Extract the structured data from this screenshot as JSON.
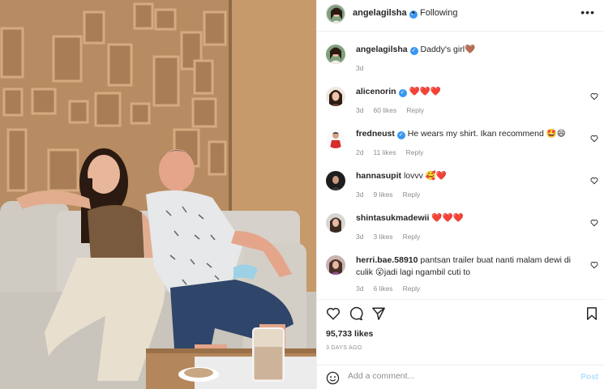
{
  "header": {
    "username": "angelagilsha",
    "dot": "•",
    "follow_status": "Following",
    "more": "•••"
  },
  "caption": {
    "username": "angelagilsha",
    "text": "Daddy's girl🤎",
    "time": "3d"
  },
  "comments": [
    {
      "username": "alicenorin",
      "text": "❤️❤️❤️",
      "time": "3d",
      "likes": "60 likes",
      "reply": "Reply",
      "verified": true
    },
    {
      "username": "fredneust",
      "text": "He wears my shirt. Ikan recommend 🤩😄",
      "time": "2d",
      "likes": "11 likes",
      "reply": "Reply",
      "verified": true
    },
    {
      "username": "hannasupit",
      "text": "lovvv 🥰❤️",
      "time": "3d",
      "likes": "9 likes",
      "reply": "Reply",
      "verified": false
    },
    {
      "username": "shintasukmadewii",
      "text": "❤️❤️❤️",
      "time": "3d",
      "likes": "3 likes",
      "reply": "Reply",
      "verified": false
    },
    {
      "username": "herri.bae.58910",
      "text": "pantsan trailer buat nanti malam dewi di culik 😮jadi lagi ngambil cuti to",
      "time": "3d",
      "likes": "6 likes",
      "reply": "Reply",
      "verified": false
    }
  ],
  "post": {
    "likes": "95,733 likes",
    "ago": "3 DAYS AGO"
  },
  "add_comment": {
    "placeholder": "Add a comment...",
    "post_label": "Post"
  },
  "icons": [
    "heart-icon",
    "comment-icon",
    "share-icon",
    "bookmark-icon",
    "emoji-icon",
    "verified-icon",
    "more-icon"
  ],
  "colors": {
    "verified": "#3897f0",
    "post_disabled": "#b2dffc",
    "meta": "#8e8e8e",
    "heart_red": "#ed4956"
  }
}
